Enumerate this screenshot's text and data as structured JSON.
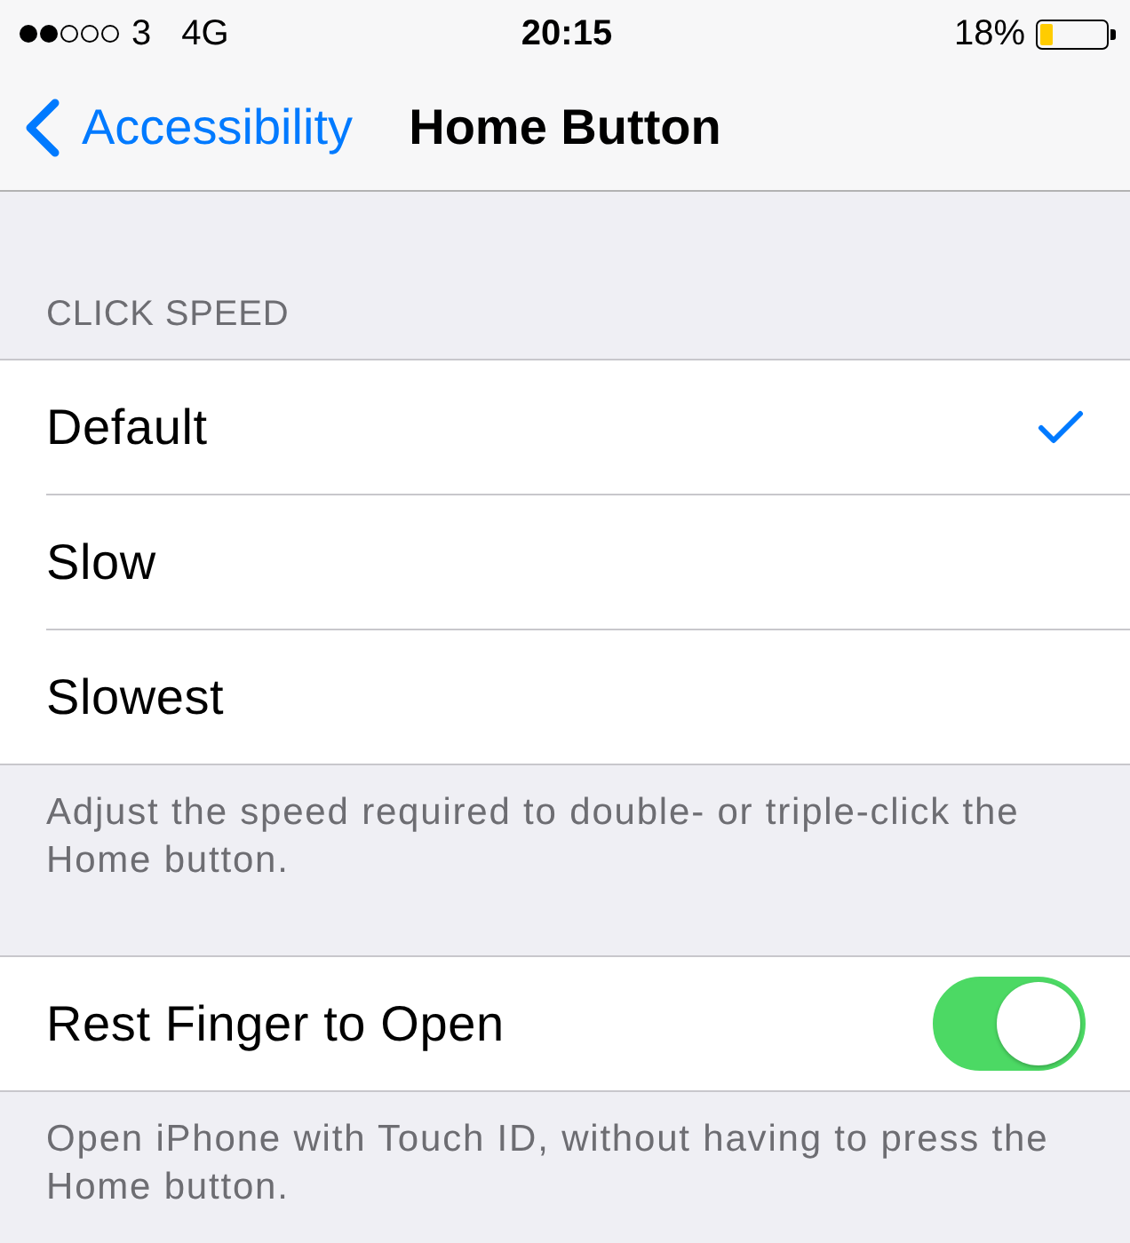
{
  "status_bar": {
    "carrier": "3",
    "network": "4G",
    "time": "20:15",
    "battery": "18%"
  },
  "nav_bar": {
    "back_label": "Accessibility",
    "title": "Home Button"
  },
  "sections": [
    {
      "header": "CLICK SPEED",
      "items": [
        {
          "kind": "choice",
          "label": "Default",
          "selected": true
        },
        {
          "kind": "choice",
          "label": "Slow",
          "selected": false
        },
        {
          "kind": "choice",
          "label": "Slowest",
          "selected": false
        }
      ],
      "footer": "Adjust the speed required to double- or triple-click the Home button."
    },
    {
      "items": [
        {
          "kind": "switch",
          "label": "Rest Finger to Open",
          "on": true
        }
      ],
      "footer": "Open iPhone with Touch ID, without having to press the Home button."
    }
  ]
}
